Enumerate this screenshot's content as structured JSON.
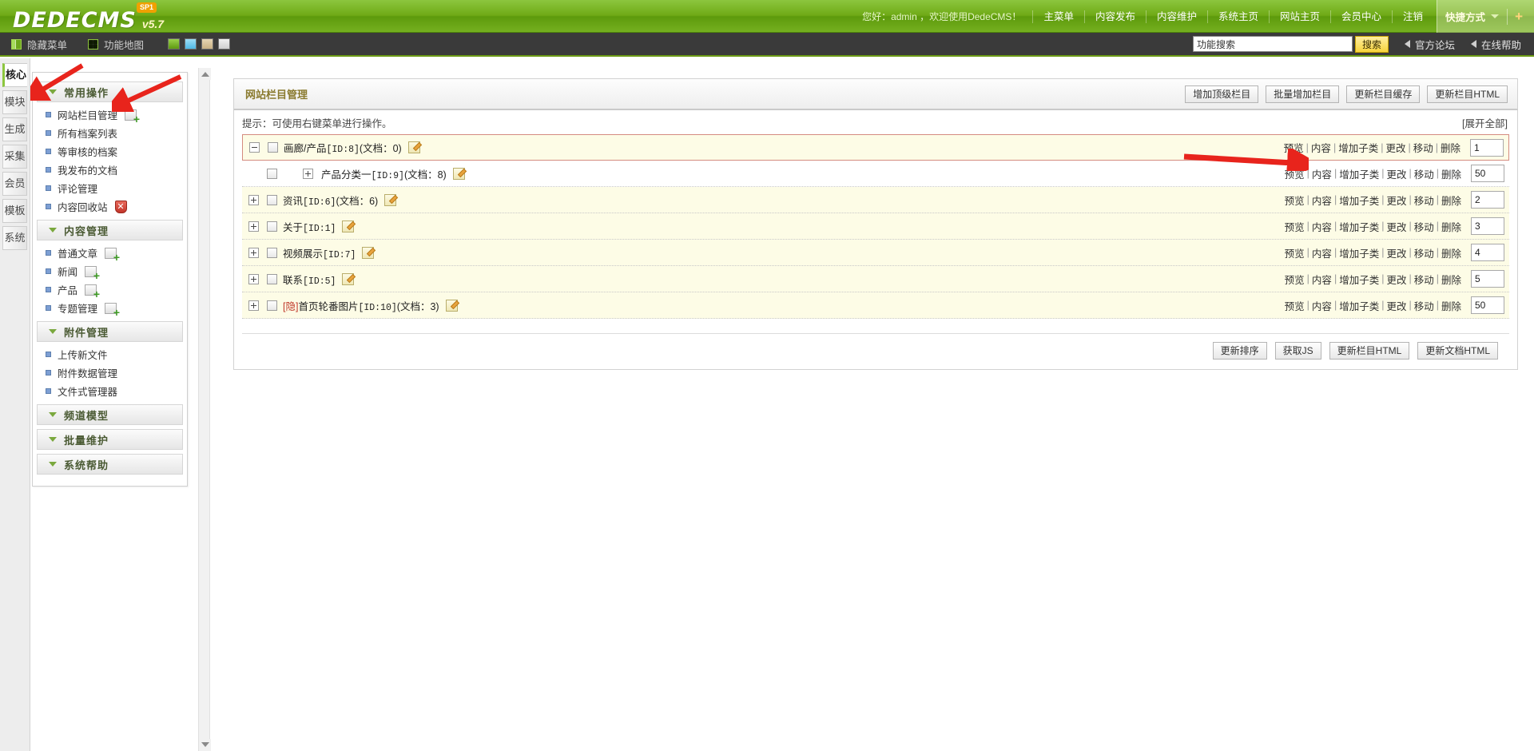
{
  "brand": {
    "name": "DEDECMS",
    "version": "v5.7",
    "sp_badge": "SP1",
    "accent_green": "#6faa16",
    "accent_yellow": "#f6d33d"
  },
  "topbar": {
    "welcome": "您好：admin ，欢迎使用DedeCMS！",
    "links": [
      "主菜单",
      "内容发布",
      "内容维护",
      "系统主页",
      "网站主页",
      "会员中心",
      "注销"
    ],
    "shortcut_label": "快捷方式",
    "shortcut_plus": "+"
  },
  "subbar": {
    "hide_menu": "隐藏菜单",
    "function_map": "功能地图",
    "search_value": "功能搜索",
    "search_placeholder": "功能搜索",
    "search_button": "搜索",
    "forum": "官方论坛",
    "help": "在线帮助"
  },
  "vtabs": [
    {
      "label": "核心",
      "active": true
    },
    {
      "label": "模块",
      "active": false
    },
    {
      "label": "生成",
      "active": false
    },
    {
      "label": "采集",
      "active": false
    },
    {
      "label": "会员",
      "active": false
    },
    {
      "label": "模板",
      "active": false
    },
    {
      "label": "系统",
      "active": false
    }
  ],
  "sidebar": {
    "groups": [
      {
        "title": "常用操作",
        "items": [
          {
            "label": "网站栏目管理",
            "badge": "add"
          },
          {
            "label": "所有档案列表",
            "badge": ""
          },
          {
            "label": "等审核的档案",
            "badge": ""
          },
          {
            "label": "我发布的文档",
            "badge": ""
          },
          {
            "label": "评论管理",
            "badge": ""
          },
          {
            "label": "内容回收站",
            "badge": "del"
          }
        ]
      },
      {
        "title": "内容管理",
        "items": [
          {
            "label": "普通文章",
            "badge": "add"
          },
          {
            "label": "新闻",
            "badge": "add"
          },
          {
            "label": "产品",
            "badge": "add"
          },
          {
            "label": "专题管理",
            "badge": "add"
          }
        ]
      },
      {
        "title": "附件管理",
        "items": [
          {
            "label": "上传新文件",
            "badge": ""
          },
          {
            "label": "附件数据管理",
            "badge": ""
          },
          {
            "label": "文件式管理器",
            "badge": ""
          }
        ]
      },
      {
        "title": "频道模型",
        "items": []
      },
      {
        "title": "批量维护",
        "items": []
      },
      {
        "title": "系统帮助",
        "items": []
      }
    ]
  },
  "panel": {
    "title": "网站栏目管理",
    "head_buttons": [
      "增加顶级栏目",
      "批量增加栏目",
      "更新栏目缓存",
      "更新栏目HTML"
    ],
    "tip": "提示：可使用右键菜单进行操作。",
    "expand_all": "[展开全部]",
    "action_labels": [
      "预览",
      "内容",
      "增加子类",
      "更改",
      "移动",
      "删除"
    ],
    "foot_buttons": [
      "更新排序",
      "获取JS",
      "更新栏目HTML",
      "更新文档HTML"
    ]
  },
  "rows": [
    {
      "name": "画廊/产品",
      "id": "[ID:8]",
      "docs": "(文档：0)",
      "sort": "1",
      "toggle": "minus",
      "child": false,
      "hidden": false,
      "shade": true,
      "selected": true
    },
    {
      "name": "产品分类一",
      "id": "[ID:9]",
      "docs": "(文档：8)",
      "sort": "50",
      "toggle": "plus",
      "child": true,
      "hidden": false,
      "shade": false,
      "selected": false
    },
    {
      "name": "资讯",
      "id": "[ID:6]",
      "docs": "(文档：6)",
      "sort": "2",
      "toggle": "plus",
      "child": false,
      "hidden": false,
      "shade": true,
      "selected": false
    },
    {
      "name": "关于",
      "id": "[ID:1]",
      "docs": "",
      "sort": "3",
      "toggle": "plus",
      "child": false,
      "hidden": false,
      "shade": true,
      "selected": false
    },
    {
      "name": "视频展示",
      "id": "[ID:7]",
      "docs": "",
      "sort": "4",
      "toggle": "plus",
      "child": false,
      "hidden": false,
      "shade": true,
      "selected": false
    },
    {
      "name": "联系",
      "id": "[ID:5]",
      "docs": "",
      "sort": "5",
      "toggle": "plus",
      "child": false,
      "hidden": false,
      "shade": true,
      "selected": false
    },
    {
      "name": "首页轮番图片",
      "id": "[ID:10]",
      "docs": "(文档：3)",
      "sort": "50",
      "toggle": "plus",
      "child": false,
      "hidden": true,
      "hidden_tag": "[隐]",
      "shade": true,
      "selected": false
    }
  ]
}
